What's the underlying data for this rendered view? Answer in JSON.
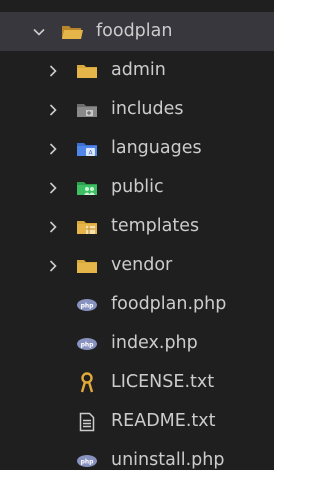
{
  "explorer": {
    "root": {
      "label": "foodplan",
      "icon": "folder-open-icon",
      "expanded": true
    },
    "items": [
      {
        "label": "admin",
        "type": "folder",
        "icon": "folder-icon"
      },
      {
        "label": "includes",
        "type": "folder",
        "icon": "folder-includes-icon"
      },
      {
        "label": "languages",
        "type": "folder",
        "icon": "folder-languages-icon"
      },
      {
        "label": "public",
        "type": "folder",
        "icon": "folder-public-icon"
      },
      {
        "label": "templates",
        "type": "folder",
        "icon": "folder-templates-icon"
      },
      {
        "label": "vendor",
        "type": "folder",
        "icon": "folder-icon"
      },
      {
        "label": "foodplan.php",
        "type": "file",
        "icon": "php-file-icon"
      },
      {
        "label": "index.php",
        "type": "file",
        "icon": "php-file-icon"
      },
      {
        "label": "LICENSE.txt",
        "type": "file",
        "icon": "license-file-icon"
      },
      {
        "label": "README.txt",
        "type": "file",
        "icon": "text-file-icon"
      },
      {
        "label": "uninstall.php",
        "type": "file",
        "icon": "php-file-icon"
      }
    ]
  },
  "colors": {
    "background": "#1f1f1f",
    "selected_row": "#37373d",
    "text": "#cccccc",
    "folder": "#d9a83a",
    "php_badge": "#8892bf",
    "license_key": "#e2a93b"
  }
}
